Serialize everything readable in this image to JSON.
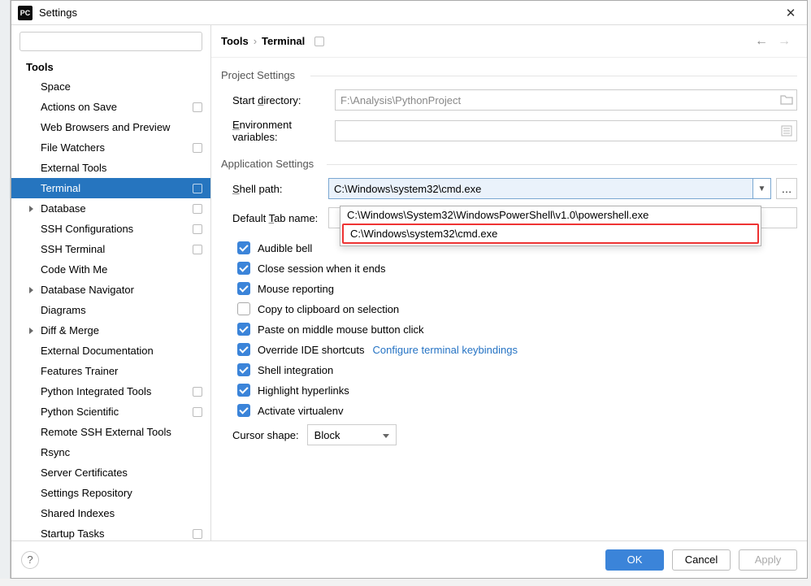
{
  "window": {
    "title": "Settings"
  },
  "search": {
    "placeholder": ""
  },
  "tree": {
    "heading": "Tools",
    "items": [
      {
        "label": "Space",
        "flag": false,
        "expandable": false
      },
      {
        "label": "Actions on Save",
        "flag": true,
        "expandable": false
      },
      {
        "label": "Web Browsers and Preview",
        "flag": false,
        "expandable": false
      },
      {
        "label": "File Watchers",
        "flag": true,
        "expandable": false
      },
      {
        "label": "External Tools",
        "flag": false,
        "expandable": false
      },
      {
        "label": "Terminal",
        "flag": true,
        "selected": true,
        "expandable": false
      },
      {
        "label": "Database",
        "flag": true,
        "expandable": true
      },
      {
        "label": "SSH Configurations",
        "flag": true,
        "expandable": false
      },
      {
        "label": "SSH Terminal",
        "flag": true,
        "expandable": false
      },
      {
        "label": "Code With Me",
        "flag": false,
        "expandable": false
      },
      {
        "label": "Database Navigator",
        "flag": false,
        "expandable": true
      },
      {
        "label": "Diagrams",
        "flag": false,
        "expandable": false
      },
      {
        "label": "Diff & Merge",
        "flag": false,
        "expandable": true
      },
      {
        "label": "External Documentation",
        "flag": false,
        "expandable": false
      },
      {
        "label": "Features Trainer",
        "flag": false,
        "expandable": false
      },
      {
        "label": "Python Integrated Tools",
        "flag": true,
        "expandable": false
      },
      {
        "label": "Python Scientific",
        "flag": true,
        "expandable": false
      },
      {
        "label": "Remote SSH External Tools",
        "flag": false,
        "expandable": false
      },
      {
        "label": "Rsync",
        "flag": false,
        "expandable": false
      },
      {
        "label": "Server Certificates",
        "flag": false,
        "expandable": false
      },
      {
        "label": "Settings Repository",
        "flag": false,
        "expandable": false
      },
      {
        "label": "Shared Indexes",
        "flag": false,
        "expandable": false
      },
      {
        "label": "Startup Tasks",
        "flag": true,
        "expandable": false
      }
    ]
  },
  "breadcrumb": {
    "root": "Tools",
    "leaf": "Terminal"
  },
  "project_section": {
    "title": "Project Settings",
    "start_dir": {
      "label_pre": "Start ",
      "label_u": "d",
      "label_post": "irectory:",
      "value": "F:\\Analysis\\PythonProject"
    },
    "env_vars": {
      "label_u": "E",
      "label_post": "nvironment variables:",
      "value": ""
    }
  },
  "app_section": {
    "title": "Application Settings",
    "shell_path": {
      "label_u": "S",
      "label_post": "hell path:",
      "value": "C:\\Windows\\system32\\cmd.exe"
    },
    "default_tab": {
      "label_pre": "Default ",
      "label_u": "T",
      "label_post": "ab name:",
      "value": ""
    },
    "dropdown": [
      "C:\\Windows\\System32\\WindowsPowerShell\\v1.0\\powershell.exe",
      "C:\\Windows\\system32\\cmd.exe"
    ],
    "checks": [
      {
        "label": "Audible bell",
        "checked": true
      },
      {
        "label": "Close session when it ends",
        "checked": true
      },
      {
        "label": "Mouse reporting",
        "checked": true
      },
      {
        "label": "Copy to clipboard on selection",
        "checked": false
      },
      {
        "label": "Paste on middle mouse button click",
        "checked": true
      },
      {
        "label": "Override IDE shortcuts",
        "checked": true,
        "link": "Configure terminal keybindings"
      },
      {
        "label": "Shell integration",
        "checked": true
      },
      {
        "label": "Highlight hyperlinks",
        "checked": true
      },
      {
        "label": "Activate virtualenv",
        "checked": true
      }
    ],
    "cursor": {
      "label": "Cursor shape:",
      "value": "Block"
    }
  },
  "footer": {
    "ok": "OK",
    "cancel": "Cancel",
    "apply": "Apply"
  }
}
